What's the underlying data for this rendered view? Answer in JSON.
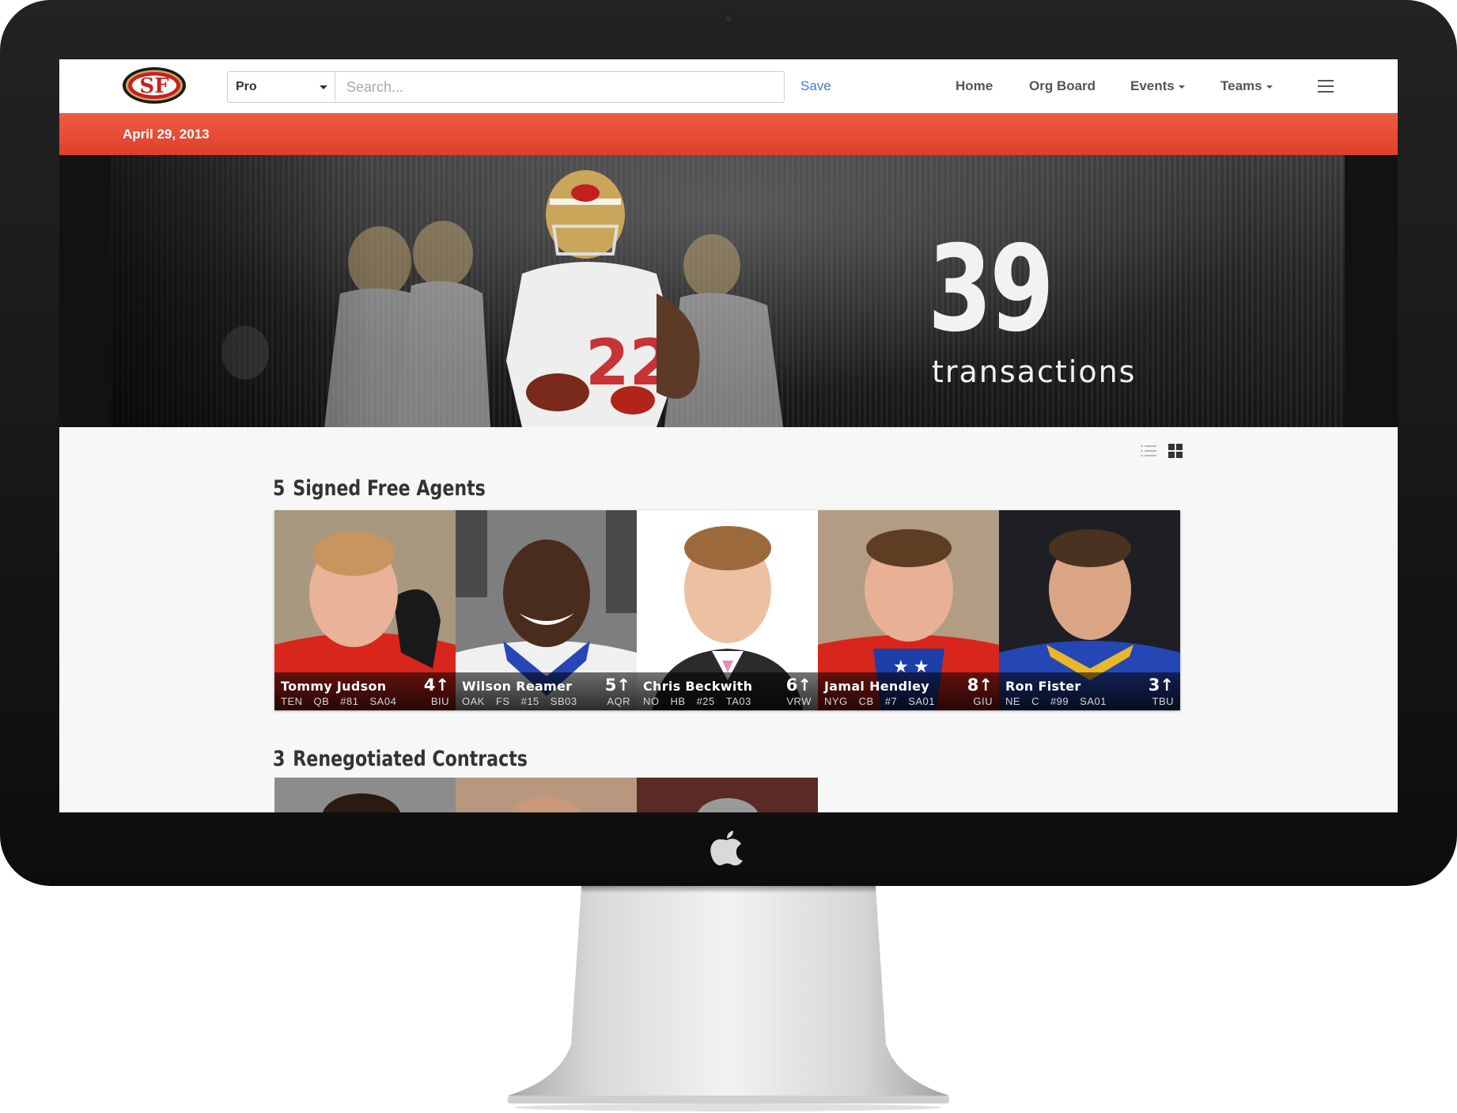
{
  "nav": {
    "logo_text": "SF",
    "select_value": "Pro",
    "search_placeholder": "Search...",
    "save_label": "Save",
    "items": [
      "Home",
      "Org Board",
      "Events",
      "Teams"
    ]
  },
  "date": "April 29, 2013",
  "hero": {
    "count": "39",
    "label": "transactions"
  },
  "sections": [
    {
      "count": "5",
      "title": "Signed Free Agents",
      "players": [
        {
          "name": "Tommy Judson",
          "rank": "4",
          "team": "TEN",
          "pos": "QB",
          "number": "#81",
          "code": "SA04",
          "source": "BIU"
        },
        {
          "name": "Wilson Reamer",
          "rank": "5",
          "team": "OAK",
          "pos": "FS",
          "number": "#15",
          "code": "SB03",
          "source": "AQR"
        },
        {
          "name": "Chris Beckwith",
          "rank": "6",
          "team": "NO",
          "pos": "HB",
          "number": "#25",
          "code": "TA03",
          "source": "VRW"
        },
        {
          "name": "Jamal Hendley",
          "rank": "8",
          "team": "NYG",
          "pos": "CB",
          "number": "#7",
          "code": "SA01",
          "source": "GIU"
        },
        {
          "name": "Ron Fister",
          "rank": "3",
          "team": "NE",
          "pos": "C",
          "number": "#99",
          "code": "SA01",
          "source": "TBU"
        }
      ]
    },
    {
      "count": "3",
      "title": "Renegotiated Contracts"
    }
  ],
  "colors": {
    "accent": "#e4492f",
    "link": "#3a7bd5",
    "jersey_red": "#d9261c",
    "jersey_blue": "#1f3fa8"
  }
}
